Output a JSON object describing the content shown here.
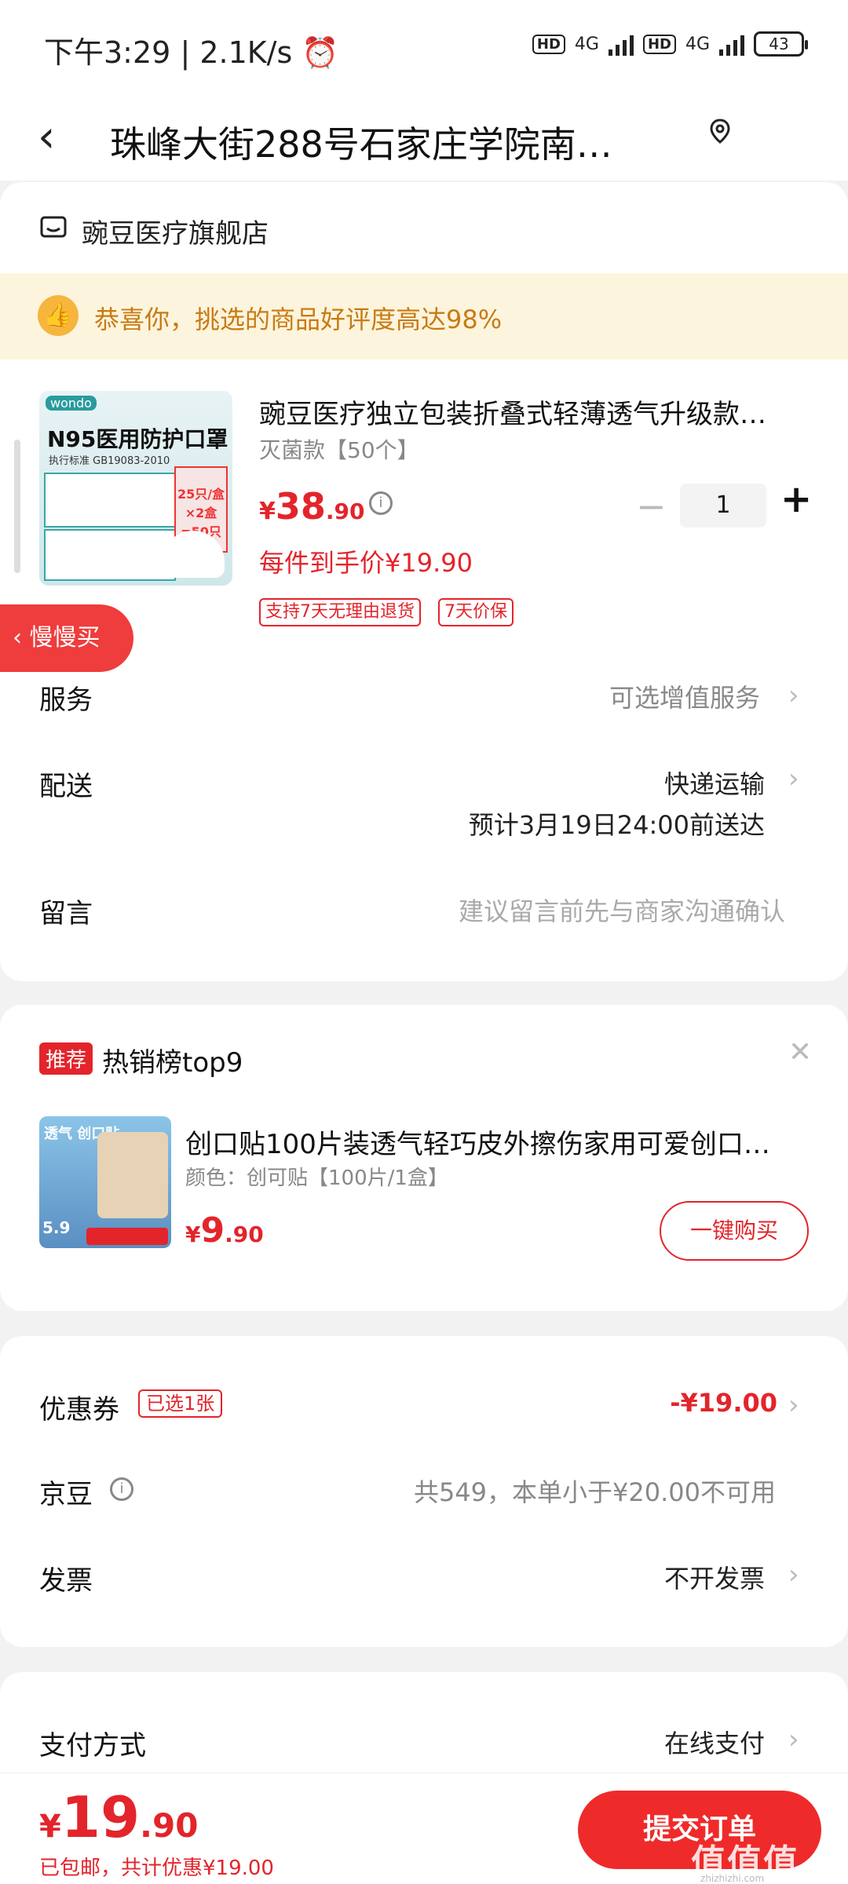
{
  "status_bar": {
    "time": "下午3:29",
    "speed": "2.1K/s",
    "hd1": "HD",
    "net1": "4G",
    "hd2": "HD",
    "net2": "4G",
    "battery": "43"
  },
  "header": {
    "address": "珠峰大街288号石家庄学院南…"
  },
  "store": {
    "name": "豌豆医疗旗舰店",
    "praise": "恭喜你，挑选的商品好评度高达98%"
  },
  "product": {
    "image_text": {
      "brand": "wondo",
      "n95": "N95医用防护口罩",
      "standard": "执行标准 GB19083-2010",
      "tag": "25只/盒×2盒 =50只"
    },
    "title": "豌豆医疗独立包装折叠式轻薄透气升级款…",
    "variant": "灭菌款【50个】",
    "price_symbol": "¥",
    "price_int": "38",
    "price_dec": ".90",
    "quantity": "1",
    "per_price": "每件到手价¥19.90",
    "tags": [
      "支持7天无理由退货",
      "7天价保"
    ]
  },
  "slow_buy": "慢慢买",
  "rows": {
    "service_label": "服务",
    "service_value": "可选增值服务",
    "delivery_label": "配送",
    "delivery_value": "快递运输",
    "delivery_eta": "预计3月19日24:00前送达",
    "note_label": "留言",
    "note_placeholder": "建议留言前先与商家沟通确认"
  },
  "recommend": {
    "badge": "推荐",
    "title": "热销榜top9",
    "image_text": {
      "t1": "透气 创口贴",
      "price": "5.9"
    },
    "item_name": "创口贴100片装透气轻巧皮外擦伤家用可爱创口…",
    "item_variant": "颜色：创可贴【100片/1盒】",
    "price_symbol": "¥",
    "price_int": "9",
    "price_dec": ".90",
    "buy_label": "一键购买"
  },
  "coupon": {
    "label": "优惠券",
    "tag": "已选1张",
    "value": "-¥19.00",
    "jd_label": "京豆",
    "jd_value": "共549，本单小于¥20.00不可用",
    "invoice_label": "发票",
    "invoice_value": "不开发票"
  },
  "payment": {
    "label": "支付方式",
    "value": "在线支付"
  },
  "bottom": {
    "price_symbol": "¥",
    "price_int": "19",
    "price_dec": ".90",
    "note": "已包邮，共计优惠¥19.00",
    "submit": "提交订单",
    "watermark": "值值值",
    "watermark_url": "zhizhizhi.com"
  },
  "colors": {
    "accent": "#e3242b",
    "praise_bg": "#fdf4dd",
    "praise_text": "#c87b14"
  }
}
